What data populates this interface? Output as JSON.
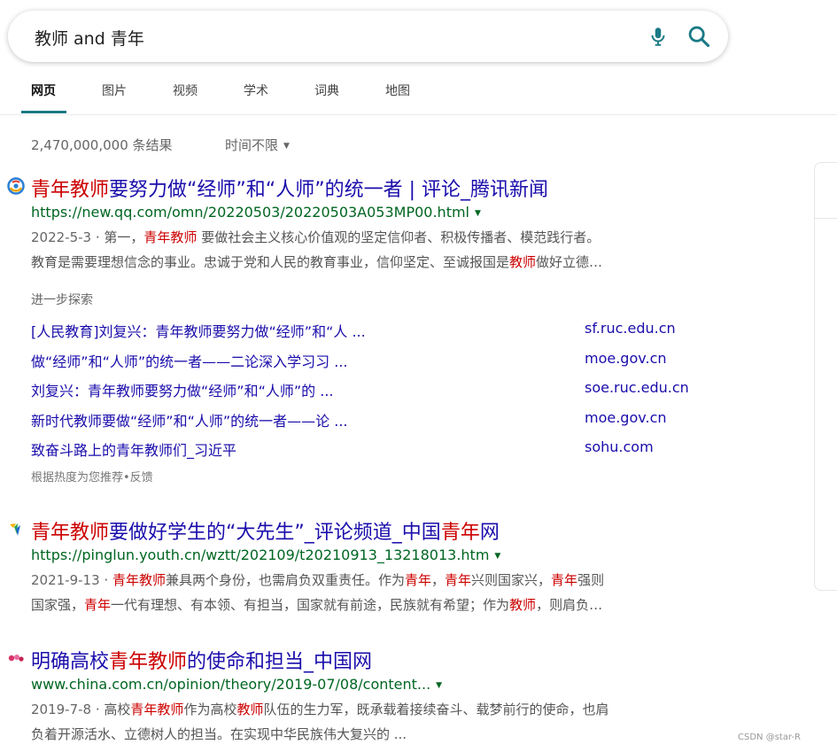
{
  "search": {
    "query": "教师 and 青年"
  },
  "tabs": [
    {
      "label": "网页",
      "active": true
    },
    {
      "label": "图片"
    },
    {
      "label": "视频"
    },
    {
      "label": "学术"
    },
    {
      "label": "词典"
    },
    {
      "label": "地图"
    }
  ],
  "results_meta": {
    "count": "2,470,000,000 条结果",
    "time_filter": "时间不限"
  },
  "results": [
    {
      "title_parts": [
        {
          "text": "青年教师",
          "hl": true
        },
        {
          "text": "要努力做“经师”和“人师”的统一者 | 评论_腾讯新闻",
          "hl": false
        }
      ],
      "url": "https://new.qq.com/omn/20220503/20220503A053MP00.html",
      "date": "2022-5-3",
      "snippet_line1": [
        {
          "text": "第一，",
          "hl": false
        },
        {
          "text": "青年教师",
          "hl": true
        },
        {
          "text": " 要做社会主义核心价值观的坚定信仰者、积极传播者、模范践行者。",
          "hl": false
        }
      ],
      "snippet_line2": [
        {
          "text": "教育是需要理想信念的事业。忠诚于党和人民的教育事业，信仰坚定、至诚报国是",
          "hl": false
        },
        {
          "text": "教师",
          "hl": true
        },
        {
          "text": "做好立德…",
          "hl": false
        }
      ]
    },
    {
      "title_parts": [
        {
          "text": "青年教师",
          "hl": true
        },
        {
          "text": "要做好学生的“大先生”_评论频道_中国",
          "hl": false
        },
        {
          "text": "青年",
          "hl": true
        },
        {
          "text": "网",
          "hl": false
        }
      ],
      "url": "https://pinglun.youth.cn/wztt/202109/t20210913_13218013.htm",
      "date": "2021-9-13",
      "snippet_line1": [
        {
          "text": " ",
          "hl": false
        },
        {
          "text": "青年教师",
          "hl": true
        },
        {
          "text": "兼具两个身份，也需肩负双重责任。作为",
          "hl": false
        },
        {
          "text": "青年",
          "hl": true
        },
        {
          "text": "，",
          "hl": false
        },
        {
          "text": "青年",
          "hl": true
        },
        {
          "text": "兴则国家兴，",
          "hl": false
        },
        {
          "text": "青年",
          "hl": true
        },
        {
          "text": "强则",
          "hl": false
        }
      ],
      "snippet_line2": [
        {
          "text": "国家强，",
          "hl": false
        },
        {
          "text": "青年",
          "hl": true
        },
        {
          "text": "一代有理想、有本领、有担当，国家就有前途，民族就有希望；作为",
          "hl": false
        },
        {
          "text": "教师",
          "hl": true
        },
        {
          "text": "，则肩负…",
          "hl": false
        }
      ]
    },
    {
      "title_parts": [
        {
          "text": "明确高校",
          "hl": false
        },
        {
          "text": "青年教师",
          "hl": true
        },
        {
          "text": "的使命和担当_中国网",
          "hl": false
        }
      ],
      "url": "www.china.com.cn/opinion/theory/2019-07/08/content...",
      "date": "2019-7-8",
      "snippet_line1": [
        {
          "text": "高校",
          "hl": false
        },
        {
          "text": "青年教师",
          "hl": true
        },
        {
          "text": "作为高校",
          "hl": false
        },
        {
          "text": "教师",
          "hl": true
        },
        {
          "text": "队伍的生力军，既承载着接续奋斗、载梦前行的使命，也肩",
          "hl": false
        }
      ],
      "snippet_line2": [
        {
          "text": "负着开源活水、立德树人的担当。在实现中华民族伟大复兴的 ...",
          "hl": false
        }
      ]
    }
  ],
  "explore": {
    "label": "进一步探索",
    "items": [
      {
        "text": "[人民教育]刘复兴：青年教师要努力做“经师”和“人 ...",
        "domain": "sf.ruc.edu.cn"
      },
      {
        "text": "做“经师”和“人师”的统一者——二论深入学习习 ...",
        "domain": "moe.gov.cn"
      },
      {
        "text": "刘复兴：青年教师要努力做“经师”和“人师”的 ...",
        "domain": "soe.ruc.edu.cn"
      },
      {
        "text": "新时代教师要做“经师”和“人师”的统一者——论 ...",
        "domain": "moe.gov.cn"
      },
      {
        "text": "致奋斗路上的青年教师们_习近平",
        "domain": "sohu.com"
      }
    ],
    "footer": "根据热度为您推荐•反馈"
  },
  "watermark": "CSDN @star-R",
  "colors": {
    "link": "#1a0dab",
    "url": "#006621",
    "highlight": "#cc0000",
    "tab_accent": "#1a7a86"
  }
}
